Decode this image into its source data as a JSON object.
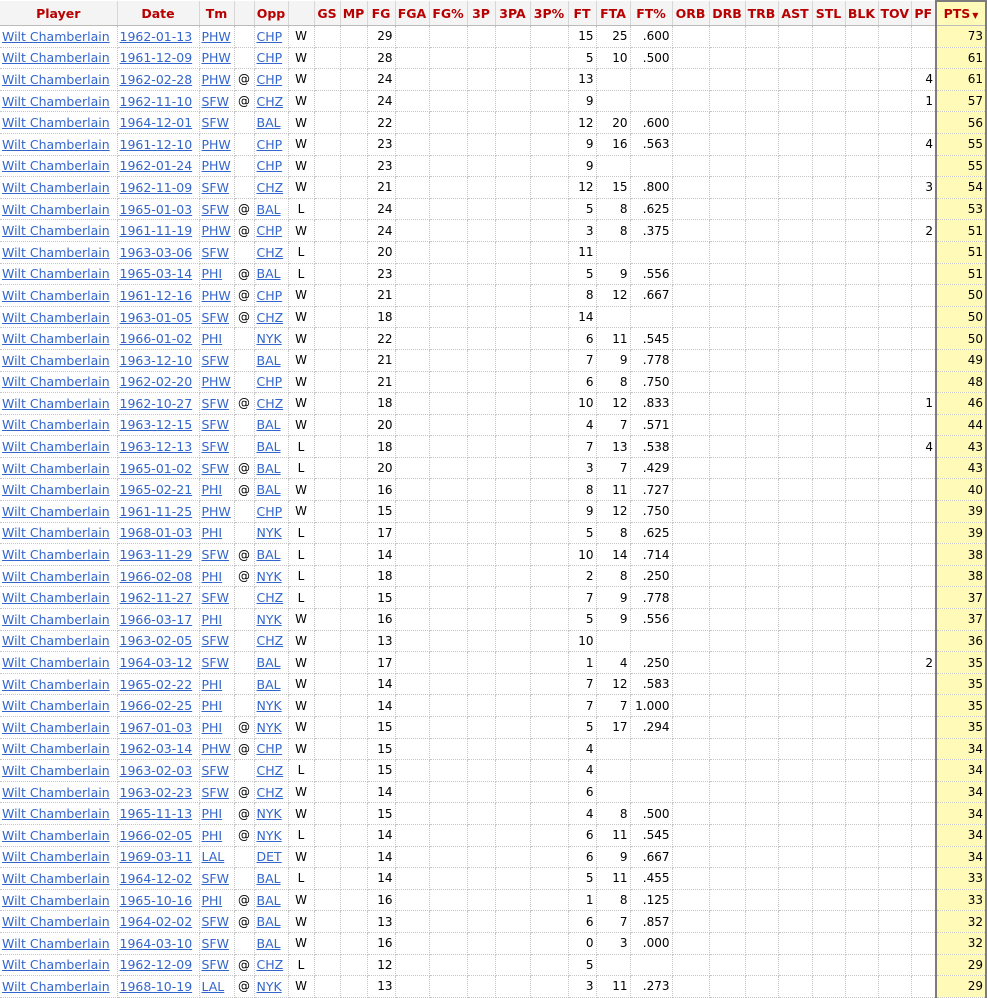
{
  "columns": {
    "player": "Player",
    "date": "Date",
    "tm": "Tm",
    "at": "",
    "opp": "Opp",
    "result": "",
    "gs": "GS",
    "mp": "MP",
    "fg": "FG",
    "fga": "FGA",
    "fg_pct": "FG%",
    "three_p": "3P",
    "three_pa": "3PA",
    "three_pct": "3P%",
    "ft": "FT",
    "fta": "FTA",
    "ft_pct": "FT%",
    "orb": "ORB",
    "drb": "DRB",
    "trb": "TRB",
    "ast": "AST",
    "stl": "STL",
    "blk": "BLK",
    "tov": "TOV",
    "pf": "PF",
    "pts": "PTS",
    "sort_arrow": "▼"
  },
  "rows": [
    {
      "player": "Wilt Chamberlain",
      "date": "1962-01-13",
      "tm": "PHW",
      "at": "",
      "opp": "CHP",
      "res": "W",
      "fg": "29",
      "ft": "15",
      "fta": "25",
      "ftp": ".600",
      "pf": "",
      "pts": "73"
    },
    {
      "player": "Wilt Chamberlain",
      "date": "1961-12-09",
      "tm": "PHW",
      "at": "",
      "opp": "CHP",
      "res": "W",
      "fg": "28",
      "ft": "5",
      "fta": "10",
      "ftp": ".500",
      "pf": "",
      "pts": "61"
    },
    {
      "player": "Wilt Chamberlain",
      "date": "1962-02-28",
      "tm": "PHW",
      "at": "@",
      "opp": "CHP",
      "res": "W",
      "fg": "24",
      "ft": "13",
      "fta": "",
      "ftp": "",
      "pf": "4",
      "pts": "61"
    },
    {
      "player": "Wilt Chamberlain",
      "date": "1962-11-10",
      "tm": "SFW",
      "at": "@",
      "opp": "CHZ",
      "res": "W",
      "fg": "24",
      "ft": "9",
      "fta": "",
      "ftp": "",
      "pf": "1",
      "pts": "57"
    },
    {
      "player": "Wilt Chamberlain",
      "date": "1964-12-01",
      "tm": "SFW",
      "at": "",
      "opp": "BAL",
      "res": "W",
      "fg": "22",
      "ft": "12",
      "fta": "20",
      "ftp": ".600",
      "pf": "",
      "pts": "56"
    },
    {
      "player": "Wilt Chamberlain",
      "date": "1961-12-10",
      "tm": "PHW",
      "at": "",
      "opp": "CHP",
      "res": "W",
      "fg": "23",
      "ft": "9",
      "fta": "16",
      "ftp": ".563",
      "pf": "4",
      "pts": "55"
    },
    {
      "player": "Wilt Chamberlain",
      "date": "1962-01-24",
      "tm": "PHW",
      "at": "",
      "opp": "CHP",
      "res": "W",
      "fg": "23",
      "ft": "9",
      "fta": "",
      "ftp": "",
      "pf": "",
      "pts": "55"
    },
    {
      "player": "Wilt Chamberlain",
      "date": "1962-11-09",
      "tm": "SFW",
      "at": "",
      "opp": "CHZ",
      "res": "W",
      "fg": "21",
      "ft": "12",
      "fta": "15",
      "ftp": ".800",
      "pf": "3",
      "pts": "54"
    },
    {
      "player": "Wilt Chamberlain",
      "date": "1965-01-03",
      "tm": "SFW",
      "at": "@",
      "opp": "BAL",
      "res": "L",
      "fg": "24",
      "ft": "5",
      "fta": "8",
      "ftp": ".625",
      "pf": "",
      "pts": "53"
    },
    {
      "player": "Wilt Chamberlain",
      "date": "1961-11-19",
      "tm": "PHW",
      "at": "@",
      "opp": "CHP",
      "res": "W",
      "fg": "24",
      "ft": "3",
      "fta": "8",
      "ftp": ".375",
      "pf": "2",
      "pts": "51"
    },
    {
      "player": "Wilt Chamberlain",
      "date": "1963-03-06",
      "tm": "SFW",
      "at": "",
      "opp": "CHZ",
      "res": "L",
      "fg": "20",
      "ft": "11",
      "fta": "",
      "ftp": "",
      "pf": "",
      "pts": "51"
    },
    {
      "player": "Wilt Chamberlain",
      "date": "1965-03-14",
      "tm": "PHI",
      "at": "@",
      "opp": "BAL",
      "res": "L",
      "fg": "23",
      "ft": "5",
      "fta": "9",
      "ftp": ".556",
      "pf": "",
      "pts": "51"
    },
    {
      "player": "Wilt Chamberlain",
      "date": "1961-12-16",
      "tm": "PHW",
      "at": "@",
      "opp": "CHP",
      "res": "W",
      "fg": "21",
      "ft": "8",
      "fta": "12",
      "ftp": ".667",
      "pf": "",
      "pts": "50"
    },
    {
      "player": "Wilt Chamberlain",
      "date": "1963-01-05",
      "tm": "SFW",
      "at": "@",
      "opp": "CHZ",
      "res": "W",
      "fg": "18",
      "ft": "14",
      "fta": "",
      "ftp": "",
      "pf": "",
      "pts": "50"
    },
    {
      "player": "Wilt Chamberlain",
      "date": "1966-01-02",
      "tm": "PHI",
      "at": "",
      "opp": "NYK",
      "res": "W",
      "fg": "22",
      "ft": "6",
      "fta": "11",
      "ftp": ".545",
      "pf": "",
      "pts": "50"
    },
    {
      "player": "Wilt Chamberlain",
      "date": "1963-12-10",
      "tm": "SFW",
      "at": "",
      "opp": "BAL",
      "res": "W",
      "fg": "21",
      "ft": "7",
      "fta": "9",
      "ftp": ".778",
      "pf": "",
      "pts": "49"
    },
    {
      "player": "Wilt Chamberlain",
      "date": "1962-02-20",
      "tm": "PHW",
      "at": "",
      "opp": "CHP",
      "res": "W",
      "fg": "21",
      "ft": "6",
      "fta": "8",
      "ftp": ".750",
      "pf": "",
      "pts": "48"
    },
    {
      "player": "Wilt Chamberlain",
      "date": "1962-10-27",
      "tm": "SFW",
      "at": "@",
      "opp": "CHZ",
      "res": "W",
      "fg": "18",
      "ft": "10",
      "fta": "12",
      "ftp": ".833",
      "pf": "1",
      "pts": "46"
    },
    {
      "player": "Wilt Chamberlain",
      "date": "1963-12-15",
      "tm": "SFW",
      "at": "",
      "opp": "BAL",
      "res": "W",
      "fg": "20",
      "ft": "4",
      "fta": "7",
      "ftp": ".571",
      "pf": "",
      "pts": "44"
    },
    {
      "player": "Wilt Chamberlain",
      "date": "1963-12-13",
      "tm": "SFW",
      "at": "",
      "opp": "BAL",
      "res": "L",
      "fg": "18",
      "ft": "7",
      "fta": "13",
      "ftp": ".538",
      "pf": "4",
      "pts": "43"
    },
    {
      "player": "Wilt Chamberlain",
      "date": "1965-01-02",
      "tm": "SFW",
      "at": "@",
      "opp": "BAL",
      "res": "L",
      "fg": "20",
      "ft": "3",
      "fta": "7",
      "ftp": ".429",
      "pf": "",
      "pts": "43"
    },
    {
      "player": "Wilt Chamberlain",
      "date": "1965-02-21",
      "tm": "PHI",
      "at": "@",
      "opp": "BAL",
      "res": "W",
      "fg": "16",
      "ft": "8",
      "fta": "11",
      "ftp": ".727",
      "pf": "",
      "pts": "40"
    },
    {
      "player": "Wilt Chamberlain",
      "date": "1961-11-25",
      "tm": "PHW",
      "at": "",
      "opp": "CHP",
      "res": "W",
      "fg": "15",
      "ft": "9",
      "fta": "12",
      "ftp": ".750",
      "pf": "",
      "pts": "39"
    },
    {
      "player": "Wilt Chamberlain",
      "date": "1968-01-03",
      "tm": "PHI",
      "at": "",
      "opp": "NYK",
      "res": "L",
      "fg": "17",
      "ft": "5",
      "fta": "8",
      "ftp": ".625",
      "pf": "",
      "pts": "39"
    },
    {
      "player": "Wilt Chamberlain",
      "date": "1963-11-29",
      "tm": "SFW",
      "at": "@",
      "opp": "BAL",
      "res": "L",
      "fg": "14",
      "ft": "10",
      "fta": "14",
      "ftp": ".714",
      "pf": "",
      "pts": "38"
    },
    {
      "player": "Wilt Chamberlain",
      "date": "1966-02-08",
      "tm": "PHI",
      "at": "@",
      "opp": "NYK",
      "res": "L",
      "fg": "18",
      "ft": "2",
      "fta": "8",
      "ftp": ".250",
      "pf": "",
      "pts": "38"
    },
    {
      "player": "Wilt Chamberlain",
      "date": "1962-11-27",
      "tm": "SFW",
      "at": "",
      "opp": "CHZ",
      "res": "L",
      "fg": "15",
      "ft": "7",
      "fta": "9",
      "ftp": ".778",
      "pf": "",
      "pts": "37"
    },
    {
      "player": "Wilt Chamberlain",
      "date": "1966-03-17",
      "tm": "PHI",
      "at": "",
      "opp": "NYK",
      "res": "W",
      "fg": "16",
      "ft": "5",
      "fta": "9",
      "ftp": ".556",
      "pf": "",
      "pts": "37"
    },
    {
      "player": "Wilt Chamberlain",
      "date": "1963-02-05",
      "tm": "SFW",
      "at": "",
      "opp": "CHZ",
      "res": "W",
      "fg": "13",
      "ft": "10",
      "fta": "",
      "ftp": "",
      "pf": "",
      "pts": "36"
    },
    {
      "player": "Wilt Chamberlain",
      "date": "1964-03-12",
      "tm": "SFW",
      "at": "",
      "opp": "BAL",
      "res": "W",
      "fg": "17",
      "ft": "1",
      "fta": "4",
      "ftp": ".250",
      "pf": "2",
      "pts": "35"
    },
    {
      "player": "Wilt Chamberlain",
      "date": "1965-02-22",
      "tm": "PHI",
      "at": "",
      "opp": "BAL",
      "res": "W",
      "fg": "14",
      "ft": "7",
      "fta": "12",
      "ftp": ".583",
      "pf": "",
      "pts": "35"
    },
    {
      "player": "Wilt Chamberlain",
      "date": "1966-02-25",
      "tm": "PHI",
      "at": "",
      "opp": "NYK",
      "res": "W",
      "fg": "14",
      "ft": "7",
      "fta": "7",
      "ftp": "1.000",
      "pf": "",
      "pts": "35"
    },
    {
      "player": "Wilt Chamberlain",
      "date": "1967-01-03",
      "tm": "PHI",
      "at": "@",
      "opp": "NYK",
      "res": "W",
      "fg": "15",
      "ft": "5",
      "fta": "17",
      "ftp": ".294",
      "pf": "",
      "pts": "35"
    },
    {
      "player": "Wilt Chamberlain",
      "date": "1962-03-14",
      "tm": "PHW",
      "at": "@",
      "opp": "CHP",
      "res": "W",
      "fg": "15",
      "ft": "4",
      "fta": "",
      "ftp": "",
      "pf": "",
      "pts": "34"
    },
    {
      "player": "Wilt Chamberlain",
      "date": "1963-02-03",
      "tm": "SFW",
      "at": "",
      "opp": "CHZ",
      "res": "L",
      "fg": "15",
      "ft": "4",
      "fta": "",
      "ftp": "",
      "pf": "",
      "pts": "34"
    },
    {
      "player": "Wilt Chamberlain",
      "date": "1963-02-23",
      "tm": "SFW",
      "at": "@",
      "opp": "CHZ",
      "res": "W",
      "fg": "14",
      "ft": "6",
      "fta": "",
      "ftp": "",
      "pf": "",
      "pts": "34"
    },
    {
      "player": "Wilt Chamberlain",
      "date": "1965-11-13",
      "tm": "PHI",
      "at": "@",
      "opp": "NYK",
      "res": "W",
      "fg": "15",
      "ft": "4",
      "fta": "8",
      "ftp": ".500",
      "pf": "",
      "pts": "34"
    },
    {
      "player": "Wilt Chamberlain",
      "date": "1966-02-05",
      "tm": "PHI",
      "at": "@",
      "opp": "NYK",
      "res": "L",
      "fg": "14",
      "ft": "6",
      "fta": "11",
      "ftp": ".545",
      "pf": "",
      "pts": "34"
    },
    {
      "player": "Wilt Chamberlain",
      "date": "1969-03-11",
      "tm": "LAL",
      "at": "",
      "opp": "DET",
      "res": "W",
      "fg": "14",
      "ft": "6",
      "fta": "9",
      "ftp": ".667",
      "pf": "",
      "pts": "34"
    },
    {
      "player": "Wilt Chamberlain",
      "date": "1964-12-02",
      "tm": "SFW",
      "at": "",
      "opp": "BAL",
      "res": "L",
      "fg": "14",
      "ft": "5",
      "fta": "11",
      "ftp": ".455",
      "pf": "",
      "pts": "33"
    },
    {
      "player": "Wilt Chamberlain",
      "date": "1965-10-16",
      "tm": "PHI",
      "at": "@",
      "opp": "BAL",
      "res": "W",
      "fg": "16",
      "ft": "1",
      "fta": "8",
      "ftp": ".125",
      "pf": "",
      "pts": "33"
    },
    {
      "player": "Wilt Chamberlain",
      "date": "1964-02-02",
      "tm": "SFW",
      "at": "@",
      "opp": "BAL",
      "res": "W",
      "fg": "13",
      "ft": "6",
      "fta": "7",
      "ftp": ".857",
      "pf": "",
      "pts": "32"
    },
    {
      "player": "Wilt Chamberlain",
      "date": "1964-03-10",
      "tm": "SFW",
      "at": "",
      "opp": "BAL",
      "res": "W",
      "fg": "16",
      "ft": "0",
      "fta": "3",
      "ftp": ".000",
      "pf": "",
      "pts": "32"
    },
    {
      "player": "Wilt Chamberlain",
      "date": "1962-12-09",
      "tm": "SFW",
      "at": "@",
      "opp": "CHZ",
      "res": "L",
      "fg": "12",
      "ft": "5",
      "fta": "",
      "ftp": "",
      "pf": "",
      "pts": "29"
    },
    {
      "player": "Wilt Chamberlain",
      "date": "1968-10-19",
      "tm": "LAL",
      "at": "@",
      "opp": "NYK",
      "res": "W",
      "fg": "13",
      "ft": "3",
      "fta": "11",
      "ftp": ".273",
      "pf": "",
      "pts": "29"
    }
  ]
}
